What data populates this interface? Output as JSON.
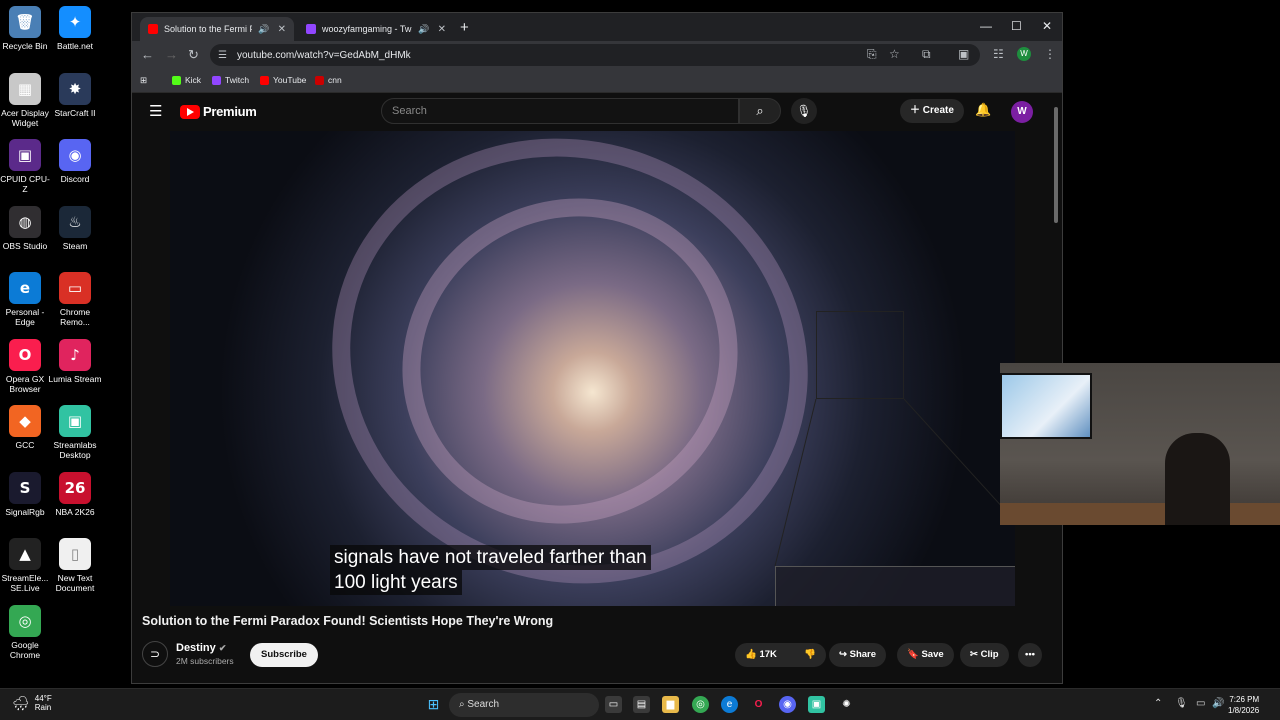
{
  "desktop": {
    "icons": [
      {
        "label": "Recycle Bin",
        "glyph": "🗑",
        "color": "#4a7fb5"
      },
      {
        "label": "Battle.net",
        "glyph": "✦",
        "color": "#148eff"
      },
      {
        "label": "Acer Display Widget",
        "glyph": "▦",
        "color": "#c8c8c8"
      },
      {
        "label": "StarCraft II",
        "glyph": "✸",
        "color": "#2a3a5a"
      },
      {
        "label": "CPUID CPU-Z",
        "glyph": "▣",
        "color": "#5b2a8a"
      },
      {
        "label": "Discord",
        "glyph": "◉",
        "color": "#5865f2"
      },
      {
        "label": "OBS Studio",
        "glyph": "◍",
        "color": "#302e31"
      },
      {
        "label": "Steam",
        "glyph": "♨",
        "color": "#1b2838"
      },
      {
        "label": "Personal - Edge",
        "glyph": "e",
        "color": "#0c7bd6"
      },
      {
        "label": "Chrome Remo...",
        "glyph": "▭",
        "color": "#d93025"
      },
      {
        "label": "Opera GX Browser",
        "glyph": "O",
        "color": "#fa1e4e"
      },
      {
        "label": "Lumia Stream",
        "glyph": "♪",
        "color": "#e0245e"
      },
      {
        "label": "GCC",
        "glyph": "◆",
        "color": "#f26522"
      },
      {
        "label": "Streamlabs Desktop",
        "glyph": "▣",
        "color": "#31c3a2"
      },
      {
        "label": "SignalRgb",
        "glyph": "S",
        "color": "#1a1a2e"
      },
      {
        "label": "NBA 2K26",
        "glyph": "26",
        "color": "#c8102e"
      },
      {
        "label": "StreamEle... SE.Live",
        "glyph": "▲",
        "color": "#222"
      },
      {
        "label": "New Text Document",
        "glyph": "▯",
        "color": "#f0f0f0"
      },
      {
        "label": "Google Chrome",
        "glyph": "◎",
        "color": "#34a853"
      }
    ]
  },
  "browser": {
    "tabs": [
      {
        "title": "Solution to the Fermi Parad",
        "favicon_color": "#ff0000"
      },
      {
        "title": "woozyfamgaming - Twitch",
        "favicon_color": "#9146ff"
      }
    ],
    "url": "youtube.com/watch?v=GedAbM_dHMk",
    "profile_initial": "W",
    "bookmarks": [
      {
        "label": "Kick",
        "color": "#53fc18"
      },
      {
        "label": "Twitch",
        "color": "#9146ff"
      },
      {
        "label": "YouTube",
        "color": "#ff0000"
      },
      {
        "label": "cnn",
        "color": "#cc0000"
      }
    ]
  },
  "youtube": {
    "brand": "Premium",
    "search_placeholder": "Search",
    "create_label": "Create",
    "avatar_initial": "W",
    "caption_line1": "signals have not traveled farther than",
    "caption_line2": "100 light years",
    "video_title": "Solution to the Fermi Paradox Found! Scientists Hope They're Wrong",
    "channel_name": "Destiny",
    "subscribers": "2M subscribers",
    "subscribe_label": "Subscribe",
    "like_count": "17K",
    "share_label": "Share",
    "save_label": "Save",
    "clip_label": "Clip"
  },
  "taskbar": {
    "temp": "44°F",
    "weather": "Rain",
    "search_label": "Search",
    "time": "7:26 PM",
    "date": "1/8/2026"
  }
}
